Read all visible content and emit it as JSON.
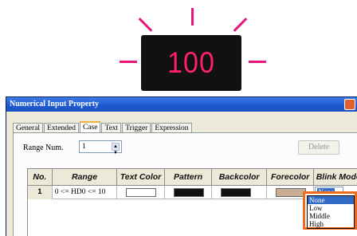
{
  "display": {
    "value": "100",
    "color": "#ff1f6e",
    "background": "#111111"
  },
  "window": {
    "title": "Numerical Input Property"
  },
  "tabs": [
    {
      "label": "General",
      "active": false
    },
    {
      "label": "Extended",
      "active": false
    },
    {
      "label": "Case",
      "active": true
    },
    {
      "label": "Text",
      "active": false
    },
    {
      "label": "Trigger",
      "active": false
    },
    {
      "label": "Expression",
      "active": false
    }
  ],
  "range_num": {
    "label": "Range Num.",
    "value": "1"
  },
  "delete_button": {
    "label": "Delete"
  },
  "table": {
    "headers": [
      "No.",
      "Range",
      "Text Color",
      "Pattern",
      "Backcolor",
      "Forecolor",
      "Blink Mode"
    ],
    "rows": [
      {
        "no": "1",
        "range": "0 <= HD0 <= 10",
        "text_color": "#ffffff",
        "pattern": "#111111",
        "backcolor": "#111111",
        "forecolor": "#c9ad94",
        "blink_mode": "None"
      }
    ]
  },
  "blink_dropdown": {
    "options": [
      "None",
      "Low",
      "Middle",
      "High"
    ],
    "selected": "None",
    "highlight_color": "#ef6a1a"
  }
}
